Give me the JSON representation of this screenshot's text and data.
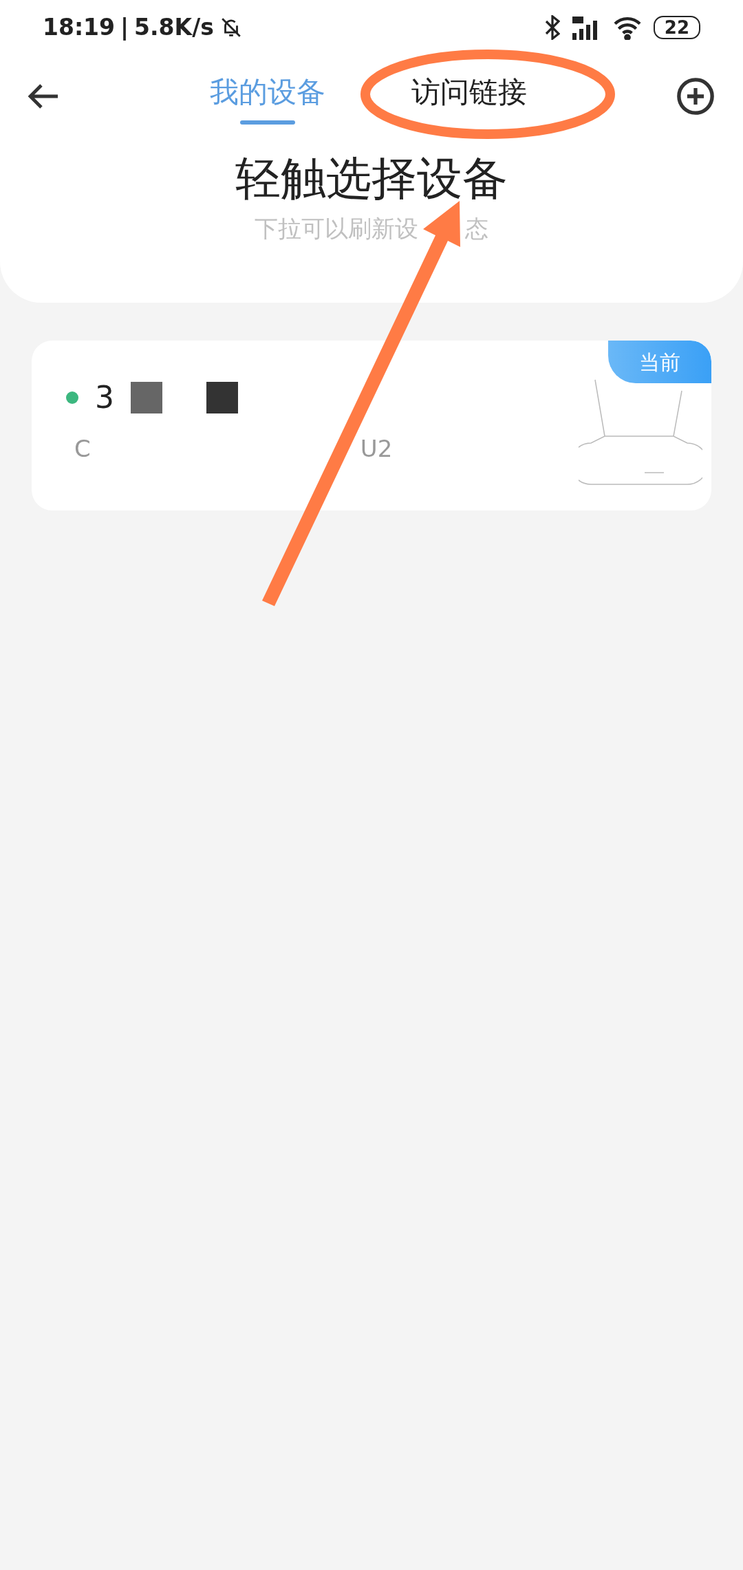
{
  "status_bar": {
    "time": "18:19",
    "separator": "|",
    "speed": "5.8K/s",
    "battery": "22"
  },
  "tabs": [
    {
      "label": "我的设备",
      "selected": true
    },
    {
      "label": "访问链接",
      "selected": false
    }
  ],
  "header": {
    "title": "轻触选择设备",
    "subtitle_start": "下拉可以刷新设",
    "subtitle_end": "态"
  },
  "devices": [
    {
      "name": "3",
      "model_start": "C",
      "model_end": "U2",
      "online": true,
      "current_badge": "当前",
      "current": true
    }
  ],
  "annotation": {
    "kind": "ellipse-arrow"
  }
}
